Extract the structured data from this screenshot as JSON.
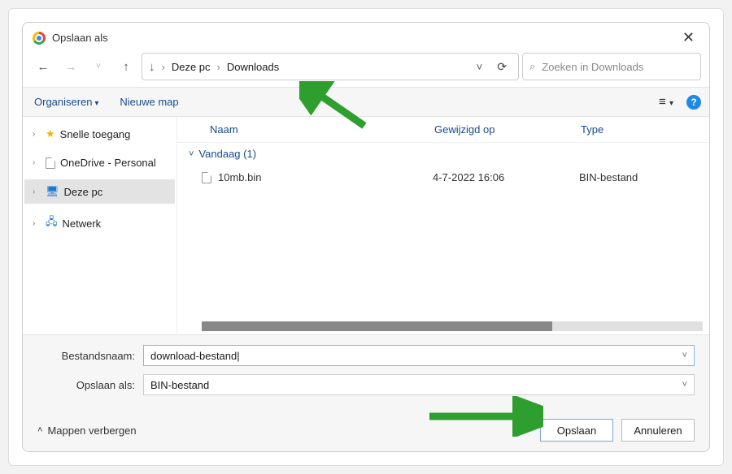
{
  "title": "Opslaan als",
  "breadcrumb": {
    "root": "Deze pc",
    "folder": "Downloads"
  },
  "search": {
    "placeholder": "Zoeken in Downloads"
  },
  "toolbar": {
    "organize": "Organiseren",
    "new_folder": "Nieuwe map"
  },
  "sidebar": {
    "items": [
      {
        "label": "Snelle toegang"
      },
      {
        "label": "OneDrive - Personal"
      },
      {
        "label": "Deze pc"
      },
      {
        "label": "Netwerk"
      }
    ]
  },
  "columns": {
    "name": "Naam",
    "modified": "Gewijzigd op",
    "type": "Type"
  },
  "group": {
    "label": "Vandaag (1)"
  },
  "files": [
    {
      "name": "10mb.bin",
      "modified": "4-7-2022 16:06",
      "type": "BIN-bestand"
    }
  ],
  "form": {
    "filename_label": "Bestandsnaam:",
    "filename_value": "download-bestand",
    "saveas_label": "Opslaan als:",
    "saveas_value": "BIN-bestand"
  },
  "actions": {
    "hide_folders": "Mappen verbergen",
    "save": "Opslaan",
    "cancel": "Annuleren"
  }
}
